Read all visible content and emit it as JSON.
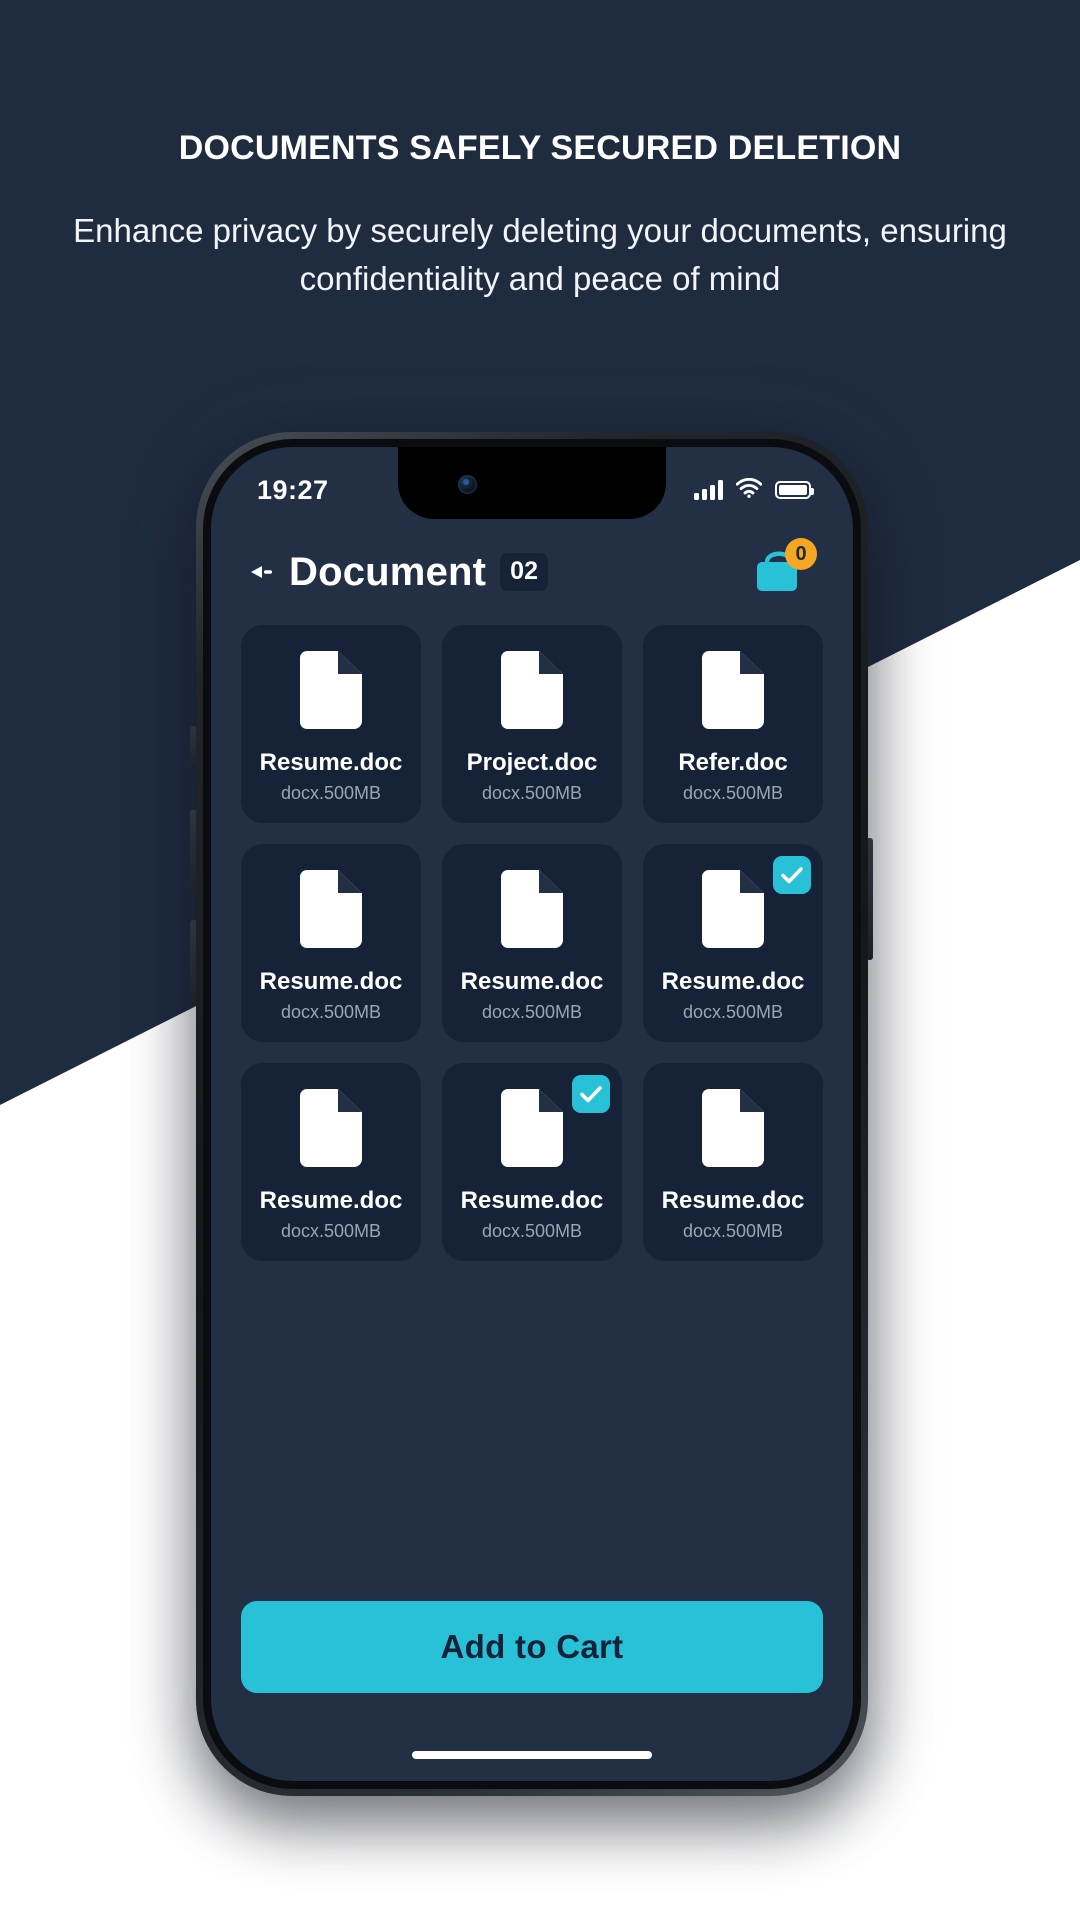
{
  "promo": {
    "title": "DOCUMENTS SAFELY SECURED DELETION",
    "subtitle": "Enhance privacy by securely deleting your documents, ensuring confidentiality and peace of mind"
  },
  "status_bar": {
    "time": "19:27",
    "signal_icon": "signal-bars-icon",
    "wifi_icon": "wifi-icon",
    "battery_icon": "battery-full-icon"
  },
  "app_header": {
    "back_icon": "back-arrow-icon",
    "title": "Document",
    "count": "02",
    "cart_icon": "shopping-bag-icon",
    "cart_badge": "0"
  },
  "documents": [
    {
      "name": "Resume.doc",
      "meta": "docx.500MB",
      "selected": false
    },
    {
      "name": "Project.doc",
      "meta": "docx.500MB",
      "selected": false
    },
    {
      "name": "Refer.doc",
      "meta": "docx.500MB",
      "selected": false
    },
    {
      "name": "Resume.doc",
      "meta": "docx.500MB",
      "selected": false
    },
    {
      "name": "Resume.doc",
      "meta": "docx.500MB",
      "selected": false
    },
    {
      "name": "Resume.doc",
      "meta": "docx.500MB",
      "selected": true
    },
    {
      "name": "Resume.doc",
      "meta": "docx.500MB",
      "selected": false
    },
    {
      "name": "Resume.doc",
      "meta": "docx.500MB",
      "selected": true
    },
    {
      "name": "Resume.doc",
      "meta": "docx.500MB",
      "selected": false
    }
  ],
  "cta": {
    "label": "Add to Cart"
  },
  "colors": {
    "background_navy": "#1f2c40",
    "screen_navy": "#222f45",
    "card_navy": "#152238",
    "accent_cyan": "#29c1d8",
    "badge_orange": "#f5a623",
    "text_white": "#ffffff",
    "text_muted": "#9aa6b6",
    "page_white": "#ffffff"
  }
}
